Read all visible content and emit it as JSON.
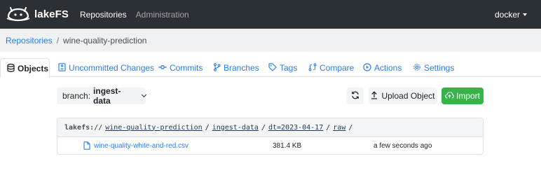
{
  "navbar": {
    "brand": "lakeFS",
    "links": [
      {
        "label": "Repositories",
        "active": true
      },
      {
        "label": "Administration",
        "active": false
      }
    ],
    "user": "docker",
    "background": "#2b3035"
  },
  "breadcrumb": {
    "root": "Repositories",
    "separator": "/",
    "current": "wine-quality-prediction"
  },
  "tabs": [
    {
      "label": "Objects",
      "icon": "database-icon",
      "active": true
    },
    {
      "label": "Uncommitted Changes",
      "icon": "file-diff-icon",
      "active": false
    },
    {
      "label": "Commits",
      "icon": "git-commit-icon",
      "active": false
    },
    {
      "label": "Branches",
      "icon": "git-branch-icon",
      "active": false
    },
    {
      "label": "Tags",
      "icon": "tag-icon",
      "active": false
    },
    {
      "label": "Compare",
      "icon": "git-compare-icon",
      "active": false
    },
    {
      "label": "Actions",
      "icon": "play-circle-icon",
      "active": false
    },
    {
      "label": "Settings",
      "icon": "gear-icon",
      "active": false
    }
  ],
  "toolbar": {
    "branch_prefix": "branch:",
    "branch_name": "ingest-data",
    "upload_label": "Upload Object",
    "import_label": "Import",
    "import_color": "#36b44a"
  },
  "objects": {
    "path_prefix": "lakefs://",
    "path_segments": [
      "wine-quality-prediction",
      "ingest-data",
      "dt=2023-04-17",
      "raw"
    ],
    "separator": "/",
    "rows": [
      {
        "name": "wine-quality-white-and-red.csv",
        "size": "381.4 KB",
        "modified": "a few seconds ago"
      }
    ]
  },
  "accent_color": "#2d7de1"
}
